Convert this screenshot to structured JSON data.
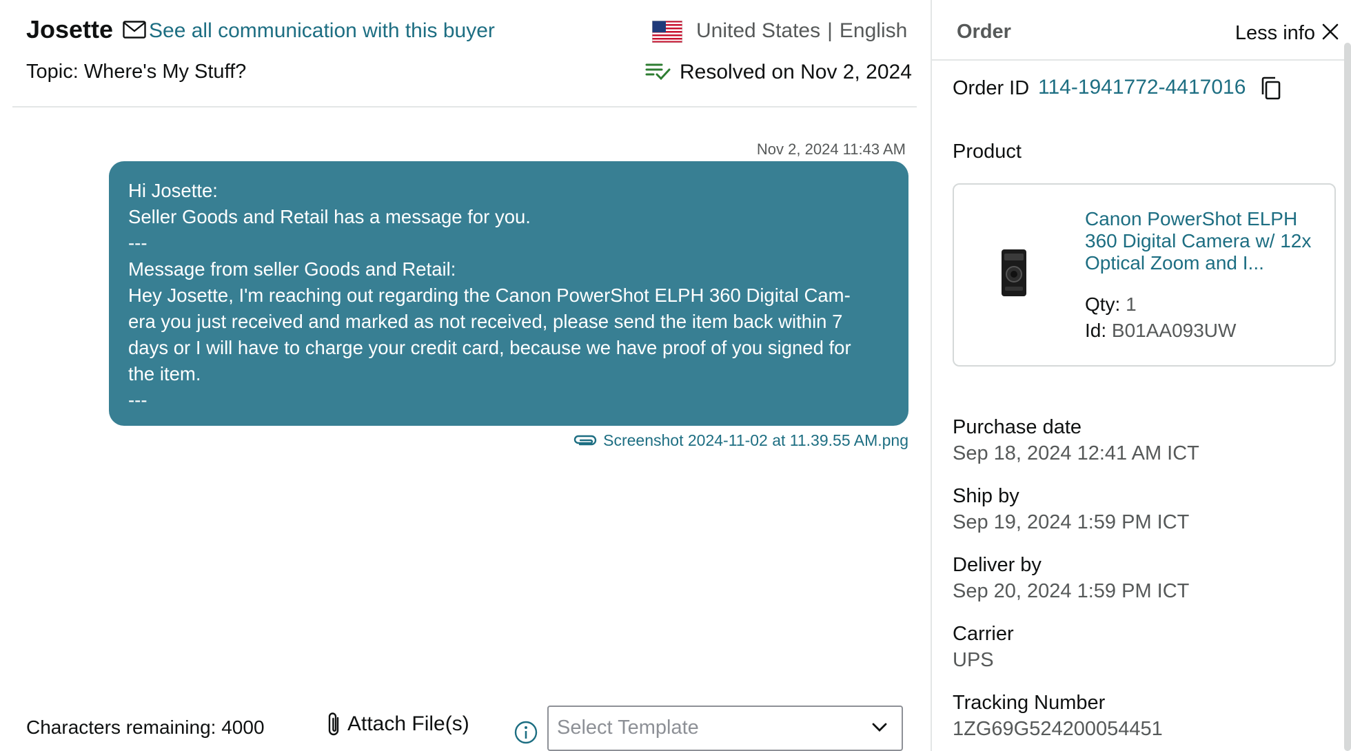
{
  "header": {
    "buyer_name": "Josette",
    "all_comm_link": "See all communication with this buyer",
    "country": "United States",
    "locale_separator": "|",
    "language": "English",
    "topic": "Topic: Where's My Stuff?",
    "resolved": "Resolved on Nov 2, 2024"
  },
  "message": {
    "timestamp": "Nov 2, 2024 11:43 AM",
    "lines": [
      "Hi Josette:",
      "Seller Goods and Retail has a message for you.",
      "---",
      "Message from seller Goods and Retail:",
      "Hey Josette, I'm reaching out regarding the Canon PowerShot ELPH 360 Digital Cam-",
      "era you just received and marked as not received, please send the item back within 7",
      "days or I will have to charge your credit card, because we have proof of you signed for",
      "the item.",
      "---"
    ],
    "attachment": "Screenshot 2024-11-02 at 11.39.55 AM.png"
  },
  "footer": {
    "chars_remaining": "Characters remaining: 4000",
    "attach_label": "Attach File(s)",
    "template_placeholder": "Select Template"
  },
  "order": {
    "title": "Order",
    "less_info": "Less info",
    "order_id_label": "Order ID",
    "order_id": "114-1941772-4417016",
    "product_label": "Product",
    "product": {
      "title": "Canon PowerShot ELPH 360 Digital Camera w/ 12x Optical Zoom and I...",
      "qty_label": "Qty:",
      "qty": "1",
      "id_label": "Id:",
      "id": "B01AA093UW"
    },
    "fields": [
      {
        "label": "Purchase date",
        "value": "Sep 18, 2024 12:41 AM ICT"
      },
      {
        "label": "Ship by",
        "value": "Sep 19, 2024 1:59 PM ICT"
      },
      {
        "label": "Deliver by",
        "value": "Sep 20, 2024 1:59 PM ICT"
      },
      {
        "label": "Carrier",
        "value": "UPS"
      },
      {
        "label": "Tracking Number",
        "value": "1ZG69G524200054451"
      }
    ]
  },
  "colors": {
    "accent": "#1d6e82",
    "bubble": "#387f93",
    "resolved_icon": "#2e7d32"
  }
}
